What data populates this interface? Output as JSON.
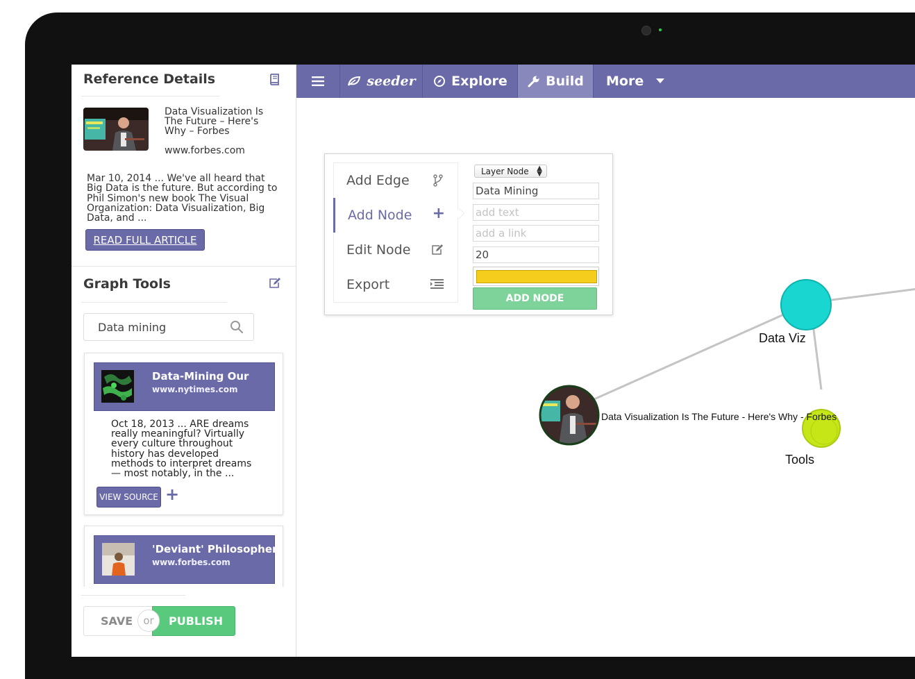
{
  "reference": {
    "heading": "Reference Details",
    "title": "Data Visualization Is The Future – Here's Why – Forbes",
    "url": "www.forbes.com",
    "snippet": "Mar 10, 2014 ... We've all heard that Big Data is the future. But according to Phil Simon's new book The Visual Organization: Data Visualization, Big Data, and ...",
    "read_button": "READ FULL ARTICLE"
  },
  "graph_tools": {
    "heading": "Graph Tools",
    "search_value": "Data mining",
    "results": [
      {
        "title": "Data-Mining Our",
        "url": "www.nytimes.com",
        "snippet": "Oct 18, 2013 ... ARE dreams really meaningful? Virtually every culture throughout history has developed methods to interpret dreams — most notably, in the ...",
        "view_button": "VIEW SOURCE",
        "add_icon": "+"
      },
      {
        "title": "'Deviant' Philosopher",
        "url": "www.forbes.com"
      }
    ]
  },
  "actions": {
    "save": "SAVE",
    "or": "or",
    "publish": "PUBLISH"
  },
  "nav": {
    "brand": "seeder",
    "explore": "Explore",
    "build": "Build",
    "more": "More"
  },
  "editor": {
    "menu": [
      {
        "label": "Add Edge",
        "icon": "branch-icon"
      },
      {
        "label": "Add Node",
        "icon": "plus-icon"
      },
      {
        "label": "Edit Node",
        "icon": "edit-icon"
      },
      {
        "label": "Export",
        "icon": "export-icon"
      }
    ],
    "active_menu": "Add Node",
    "plus_glyph": "+",
    "layer_select": "Layer Node",
    "name_value": "Data Mining",
    "text_placeholder": "add text",
    "link_placeholder": "add a link",
    "size_value": "20",
    "color_value": "#f5cd1c",
    "submit": "ADD NODE"
  },
  "graph": {
    "nodes": [
      {
        "label": "Data Viz",
        "color": "#19d6d0"
      },
      {
        "label": "Data Visualization Is The Future - Here's Why - Forbes",
        "color": "#1a3d1a"
      },
      {
        "label": "Tools",
        "color": "#c6e617"
      }
    ],
    "edge_color": "#c4c4c4"
  },
  "colors": {
    "accent": "#6b6aa8",
    "success": "#59c97d"
  }
}
